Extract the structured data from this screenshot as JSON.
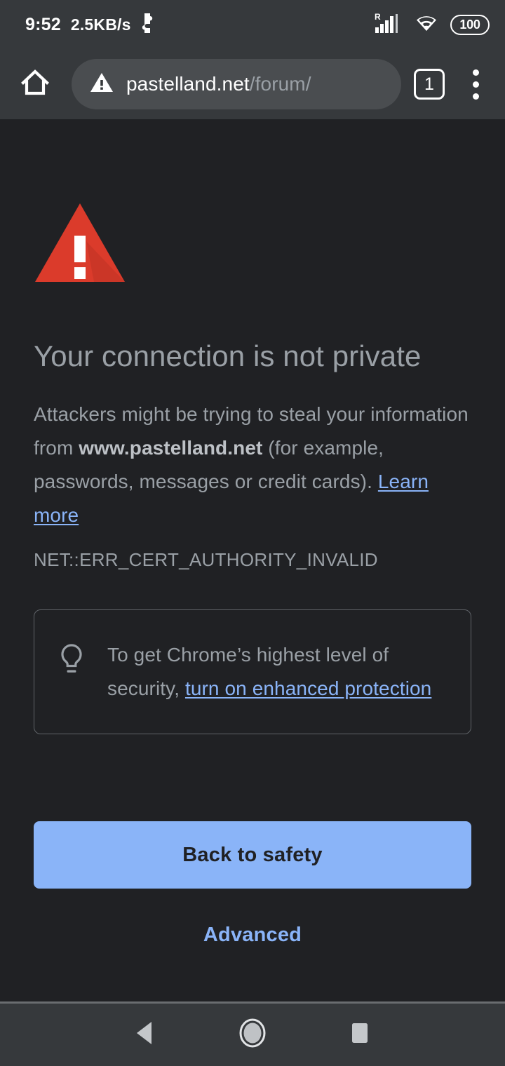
{
  "statusbar": {
    "clock": "9:52",
    "network_speed": "2.5KB/s",
    "roaming_label": "R",
    "battery_level": "100",
    "icons": {
      "puzzle": "puzzle-icon",
      "signal": "signal-bars-icon",
      "wifi": "wifi-icon",
      "battery": "battery-icon"
    }
  },
  "toolbar": {
    "home_icon": "home-icon",
    "security_icon": "warning-triangle-icon",
    "url_domain": "pastelland.net",
    "url_path": "/forum/",
    "tab_count": "1",
    "menu_icon": "overflow-menu-icon"
  },
  "page": {
    "headline": "Your connection is not private",
    "body_before": "Attackers might be trying to steal your information from ",
    "body_host": "www.pastelland.net",
    "body_after": " (for example, passwords, messages or credit cards). ",
    "learn_more": "Learn more",
    "error_code": "NET::ERR_CERT_AUTHORITY_INVALID",
    "warning_icon": "warning-triangle-icon"
  },
  "tip": {
    "icon": "lightbulb-icon",
    "text_before": "To get Chrome’s highest level of security, ",
    "link_text": "turn on enhanced protection"
  },
  "actions": {
    "primary_label": "Back to safety",
    "advanced_label": "Advanced"
  },
  "navbar": {
    "back_icon": "back-triangle-icon",
    "home_icon": "home-circle-icon",
    "recents_icon": "recents-square-icon"
  },
  "colors": {
    "page_bg": "#202124",
    "chrome_bg": "#36393C",
    "omnibox_bg": "#4A4D50",
    "text_primary": "#9AA0A6",
    "text_bold": "#BDC1C6",
    "link_blue": "#8AB4F8",
    "warning_red": "#DB3B2B",
    "button_bg": "#8AB4F8",
    "button_text": "#202124",
    "border_gray": "#5F6368"
  }
}
